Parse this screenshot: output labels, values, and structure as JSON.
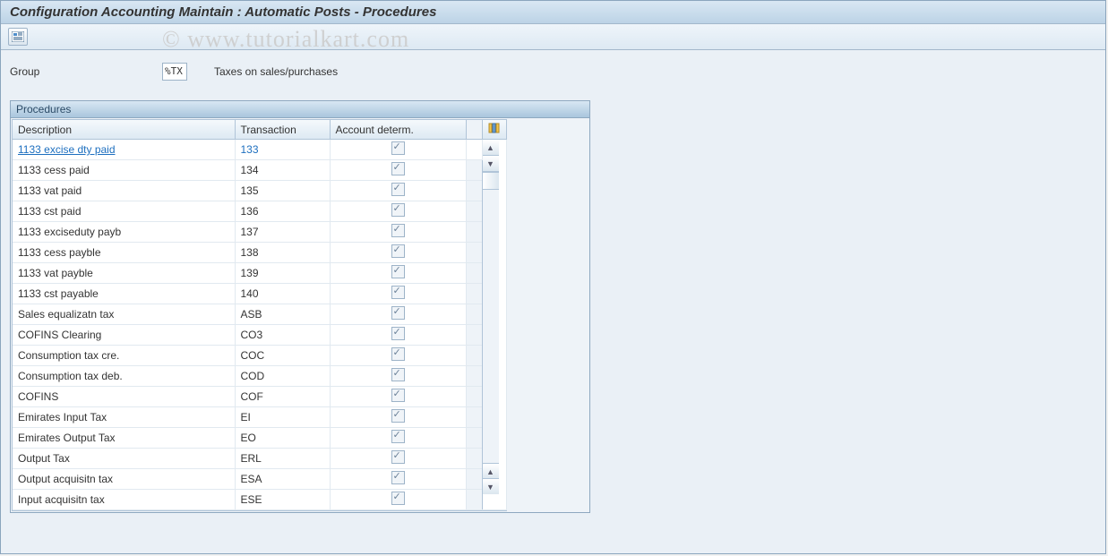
{
  "title": "Configuration Accounting Maintain : Automatic Posts - Procedures",
  "watermark": "© www.tutorialkart.com",
  "group": {
    "label": "Group",
    "code": "%TX",
    "desc": "Taxes on sales/purchases"
  },
  "panel": {
    "title": "Procedures",
    "columns": {
      "description": "Description",
      "transaction": "Transaction",
      "account_determ": "Account determ."
    },
    "rows": [
      {
        "desc": "1133 excise dty paid",
        "trans": "133",
        "acc": true,
        "selected": true
      },
      {
        "desc": "1133 cess paid",
        "trans": "134",
        "acc": true
      },
      {
        "desc": "1133 vat paid",
        "trans": "135",
        "acc": true
      },
      {
        "desc": "1133 cst paid",
        "trans": "136",
        "acc": true
      },
      {
        "desc": "1133 exciseduty payb",
        "trans": "137",
        "acc": true
      },
      {
        "desc": "1133 cess payble",
        "trans": "138",
        "acc": true
      },
      {
        "desc": "1133 vat payble",
        "trans": "139",
        "acc": true
      },
      {
        "desc": "1133 cst payable",
        "trans": "140",
        "acc": true
      },
      {
        "desc": "Sales equalizatn tax",
        "trans": "ASB",
        "acc": true
      },
      {
        "desc": "COFINS Clearing",
        "trans": "CO3",
        "acc": true
      },
      {
        "desc": "Consumption tax cre.",
        "trans": "COC",
        "acc": true
      },
      {
        "desc": "Consumption tax deb.",
        "trans": "COD",
        "acc": true
      },
      {
        "desc": "COFINS",
        "trans": "COF",
        "acc": true
      },
      {
        "desc": "Emirates Input Tax",
        "trans": "EI",
        "acc": true
      },
      {
        "desc": "Emirates Output Tax",
        "trans": "EO",
        "acc": true
      },
      {
        "desc": "Output Tax",
        "trans": "ERL",
        "acc": true
      },
      {
        "desc": "Output acquisitn tax",
        "trans": "ESA",
        "acc": true
      },
      {
        "desc": "Input acquisitn tax",
        "trans": "ESE",
        "acc": true
      }
    ]
  }
}
